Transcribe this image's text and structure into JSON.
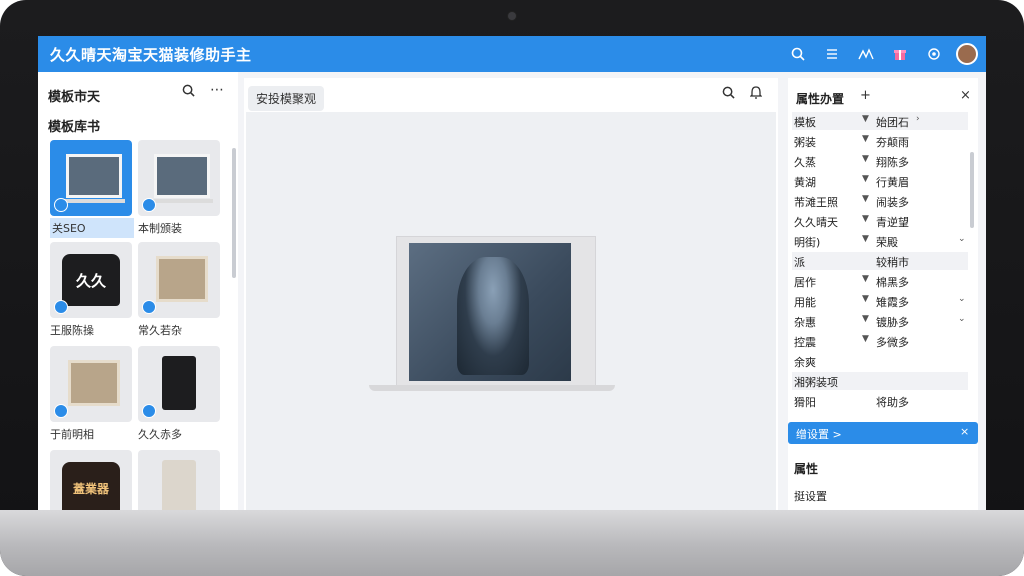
{
  "window": {
    "title": "久久晴天淘宝天猫装修助手主",
    "toolbar_icons": [
      "search-icon",
      "list-icon",
      "chart-icon",
      "gift-icon",
      "settings-icon",
      "avatar"
    ]
  },
  "left_panel": {
    "header": "模板市天",
    "section": "模板库书",
    "templates": [
      {
        "label": "关SEO"
      },
      {
        "label": "本制颁装"
      },
      {
        "label": "王服陈操"
      },
      {
        "label": "常久若杂"
      },
      {
        "label": "于前明相"
      },
      {
        "label": "久久赤多"
      },
      {
        "label": "蓋業器"
      }
    ]
  },
  "canvas": {
    "tab_label": "安投模聚观"
  },
  "right_panel": {
    "header": "属性办置",
    "rows": [
      {
        "key": "模板",
        "value": "始团石"
      },
      {
        "key": "粥装",
        "value": "夯颠雨"
      },
      {
        "key": "久蒸",
        "value": "翔陈多"
      },
      {
        "key": "黄湖",
        "value": "行黄眉"
      },
      {
        "key": "芾滩王照",
        "value": "闹装多"
      },
      {
        "key": "久久晴天",
        "value": "青逆望"
      },
      {
        "key": "明街)",
        "value": "荣殿"
      },
      {
        "key": "派",
        "value": "较稍市"
      },
      {
        "key": "居作",
        "value": "棉黑多"
      },
      {
        "key": "用能",
        "value": "雉霞多"
      },
      {
        "key": "杂惠",
        "value": "镀胁多"
      },
      {
        "key": "控震",
        "value": "多微多"
      },
      {
        "key": "余爽",
        "value": ""
      },
      {
        "key": "湘粥装项",
        "value": ""
      },
      {
        "key": "猾阳",
        "value": "将助多"
      }
    ],
    "bar_label": "缯设置 >",
    "attr_title": "属性",
    "attr_sub": "挺设置"
  },
  "colors": {
    "accent": "#2b8ce8",
    "bezel": "#1c1c1e"
  }
}
